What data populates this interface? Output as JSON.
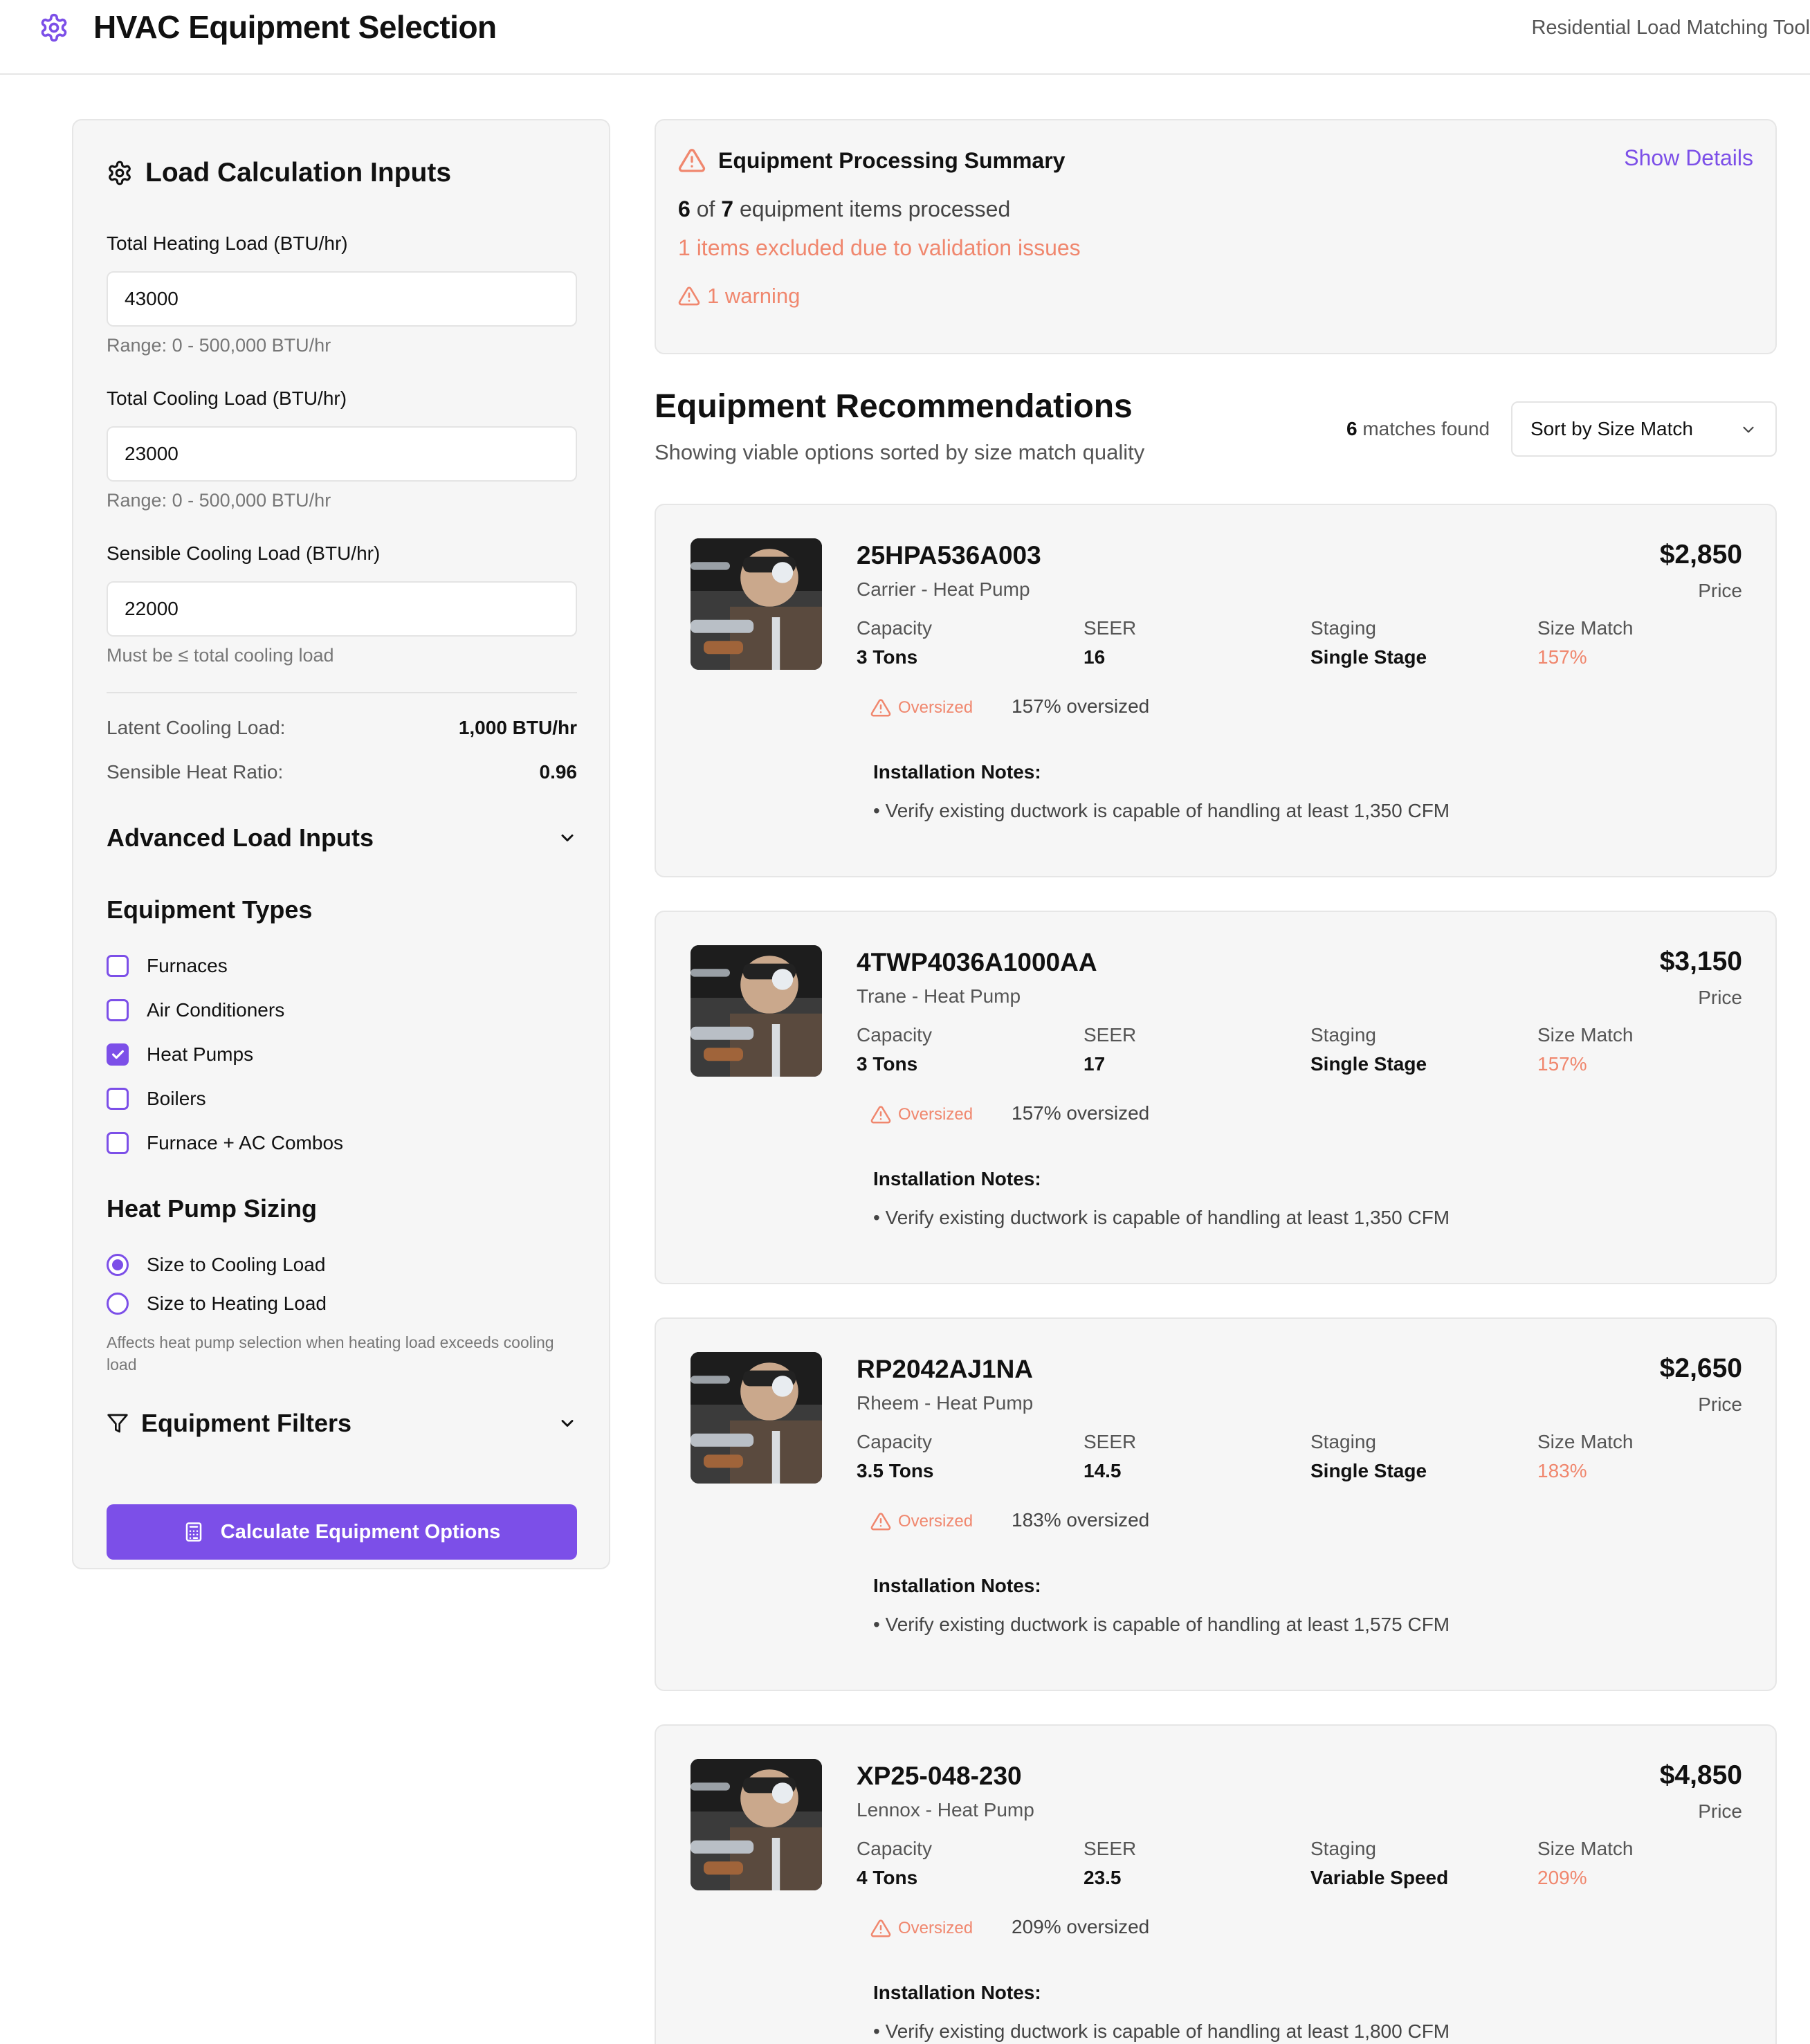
{
  "header": {
    "title": "HVAC Equipment Selection",
    "tool_name": "Residential Load Matching Tool",
    "logo_icon": "gear-icon",
    "accent": "#7c4fe8"
  },
  "inputs": {
    "title": "Load Calculation Inputs",
    "heating_label": "Total Heating Load (BTU/hr)",
    "heating_value": "43000",
    "heating_help": "Range: 0 - 500,000 BTU/hr",
    "cooling_label": "Total Cooling Load (BTU/hr)",
    "cooling_value": "23000",
    "cooling_help": "Range: 0 - 500,000 BTU/hr",
    "sensible_label": "Sensible Cooling Load (BTU/hr)",
    "sensible_value": "22000",
    "sensible_help": "Must be ≤ total cooling load",
    "latent_label": "Latent Cooling Load:",
    "latent_value": "1,000 BTU/hr",
    "shr_label": "Sensible Heat Ratio:",
    "shr_value": "0.96",
    "advanced_label": "Advanced Load Inputs"
  },
  "equipment_types": {
    "title": "Equipment Types",
    "items": [
      {
        "label": "Furnaces",
        "checked": false
      },
      {
        "label": "Air Conditioners",
        "checked": false
      },
      {
        "label": "Heat Pumps",
        "checked": true
      },
      {
        "label": "Boilers",
        "checked": false
      },
      {
        "label": "Furnace + AC Combos",
        "checked": false
      }
    ]
  },
  "sizing": {
    "title": "Heat Pump Sizing",
    "options": [
      {
        "label": "Size to Cooling Load",
        "selected": true
      },
      {
        "label": "Size to Heating Load",
        "selected": false
      }
    ],
    "help": "Affects heat pump selection when heating load exceeds cooling load"
  },
  "filters": {
    "title": "Equipment Filters"
  },
  "calculate_button": "Calculate Equipment Options",
  "summary": {
    "title": "Equipment Processing Summary",
    "show_details": "Show Details",
    "processed_count": "6",
    "of_word": " of ",
    "total_count": "7",
    "processed_suffix": " equipment items processed",
    "excluded": "1 items excluded due to validation issues",
    "warning": "1 warning",
    "warn_color": "#f0876e"
  },
  "recommendations": {
    "title": "Equipment Recommendations",
    "subtitle": "Showing viable options sorted by size match quality",
    "matches_count": "6",
    "matches_suffix": " matches found",
    "sort_value": "Sort by Size Match"
  },
  "labels": {
    "price": "Price",
    "capacity": "Capacity",
    "seer": "SEER",
    "staging": "Staging",
    "size_match": "Size Match",
    "badge": "Oversized",
    "notes": "Installation Notes:"
  },
  "cards": [
    {
      "model": "25HPA536A003",
      "brand": "Carrier - Heat Pump",
      "price": "$2,850",
      "capacity": "3 Tons",
      "seer": "16",
      "staging": "Single Stage",
      "size_match": "157%",
      "oversized_text": "157% oversized",
      "note": "• Verify existing ductwork is capable of handling at least 1,350 CFM"
    },
    {
      "model": "4TWP4036A1000AA",
      "brand": "Trane - Heat Pump",
      "price": "$3,150",
      "capacity": "3 Tons",
      "seer": "17",
      "staging": "Single Stage",
      "size_match": "157%",
      "oversized_text": "157% oversized",
      "note": "• Verify existing ductwork is capable of handling at least 1,350 CFM"
    },
    {
      "model": "RP2042AJ1NA",
      "brand": "Rheem - Heat Pump",
      "price": "$2,650",
      "capacity": "3.5 Tons",
      "seer": "14.5",
      "staging": "Single Stage",
      "size_match": "183%",
      "oversized_text": "183% oversized",
      "note": "• Verify existing ductwork is capable of handling at least 1,575 CFM"
    },
    {
      "model": "XP25-048-230",
      "brand": "Lennox - Heat Pump",
      "price": "$4,850",
      "capacity": "4 Tons",
      "seer": "23.5",
      "staging": "Variable Speed",
      "size_match": "209%",
      "oversized_text": "209% oversized",
      "note": "• Verify existing ductwork is capable of handling at least 1,800 CFM"
    }
  ]
}
